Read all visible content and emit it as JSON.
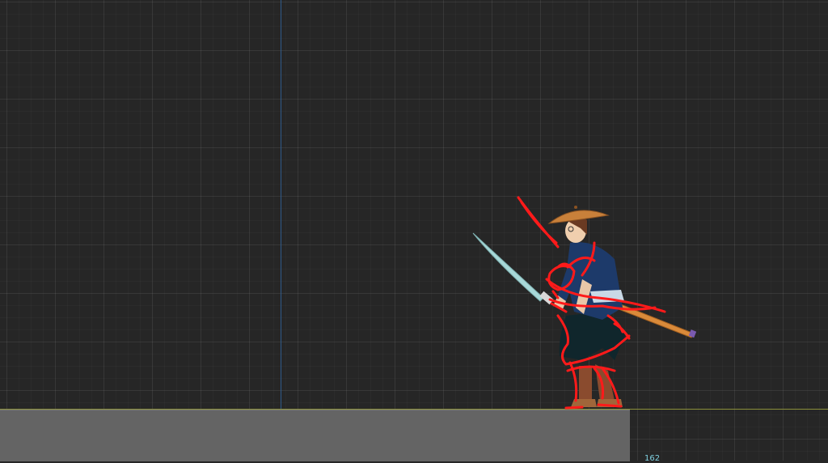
{
  "viewport": {
    "frame_readout": "162"
  },
  "colors": {
    "background": "#262626",
    "grid_line": "#3a3a3a",
    "origin_axis": "#2f5a8a",
    "ground_block": "#646464",
    "ground_line": "#8a8f3a",
    "sketch_stroke": "#ff1a1a",
    "readout_text": "#7fd0e0"
  },
  "icons": {
    "character": "samurai-character-illustration"
  }
}
